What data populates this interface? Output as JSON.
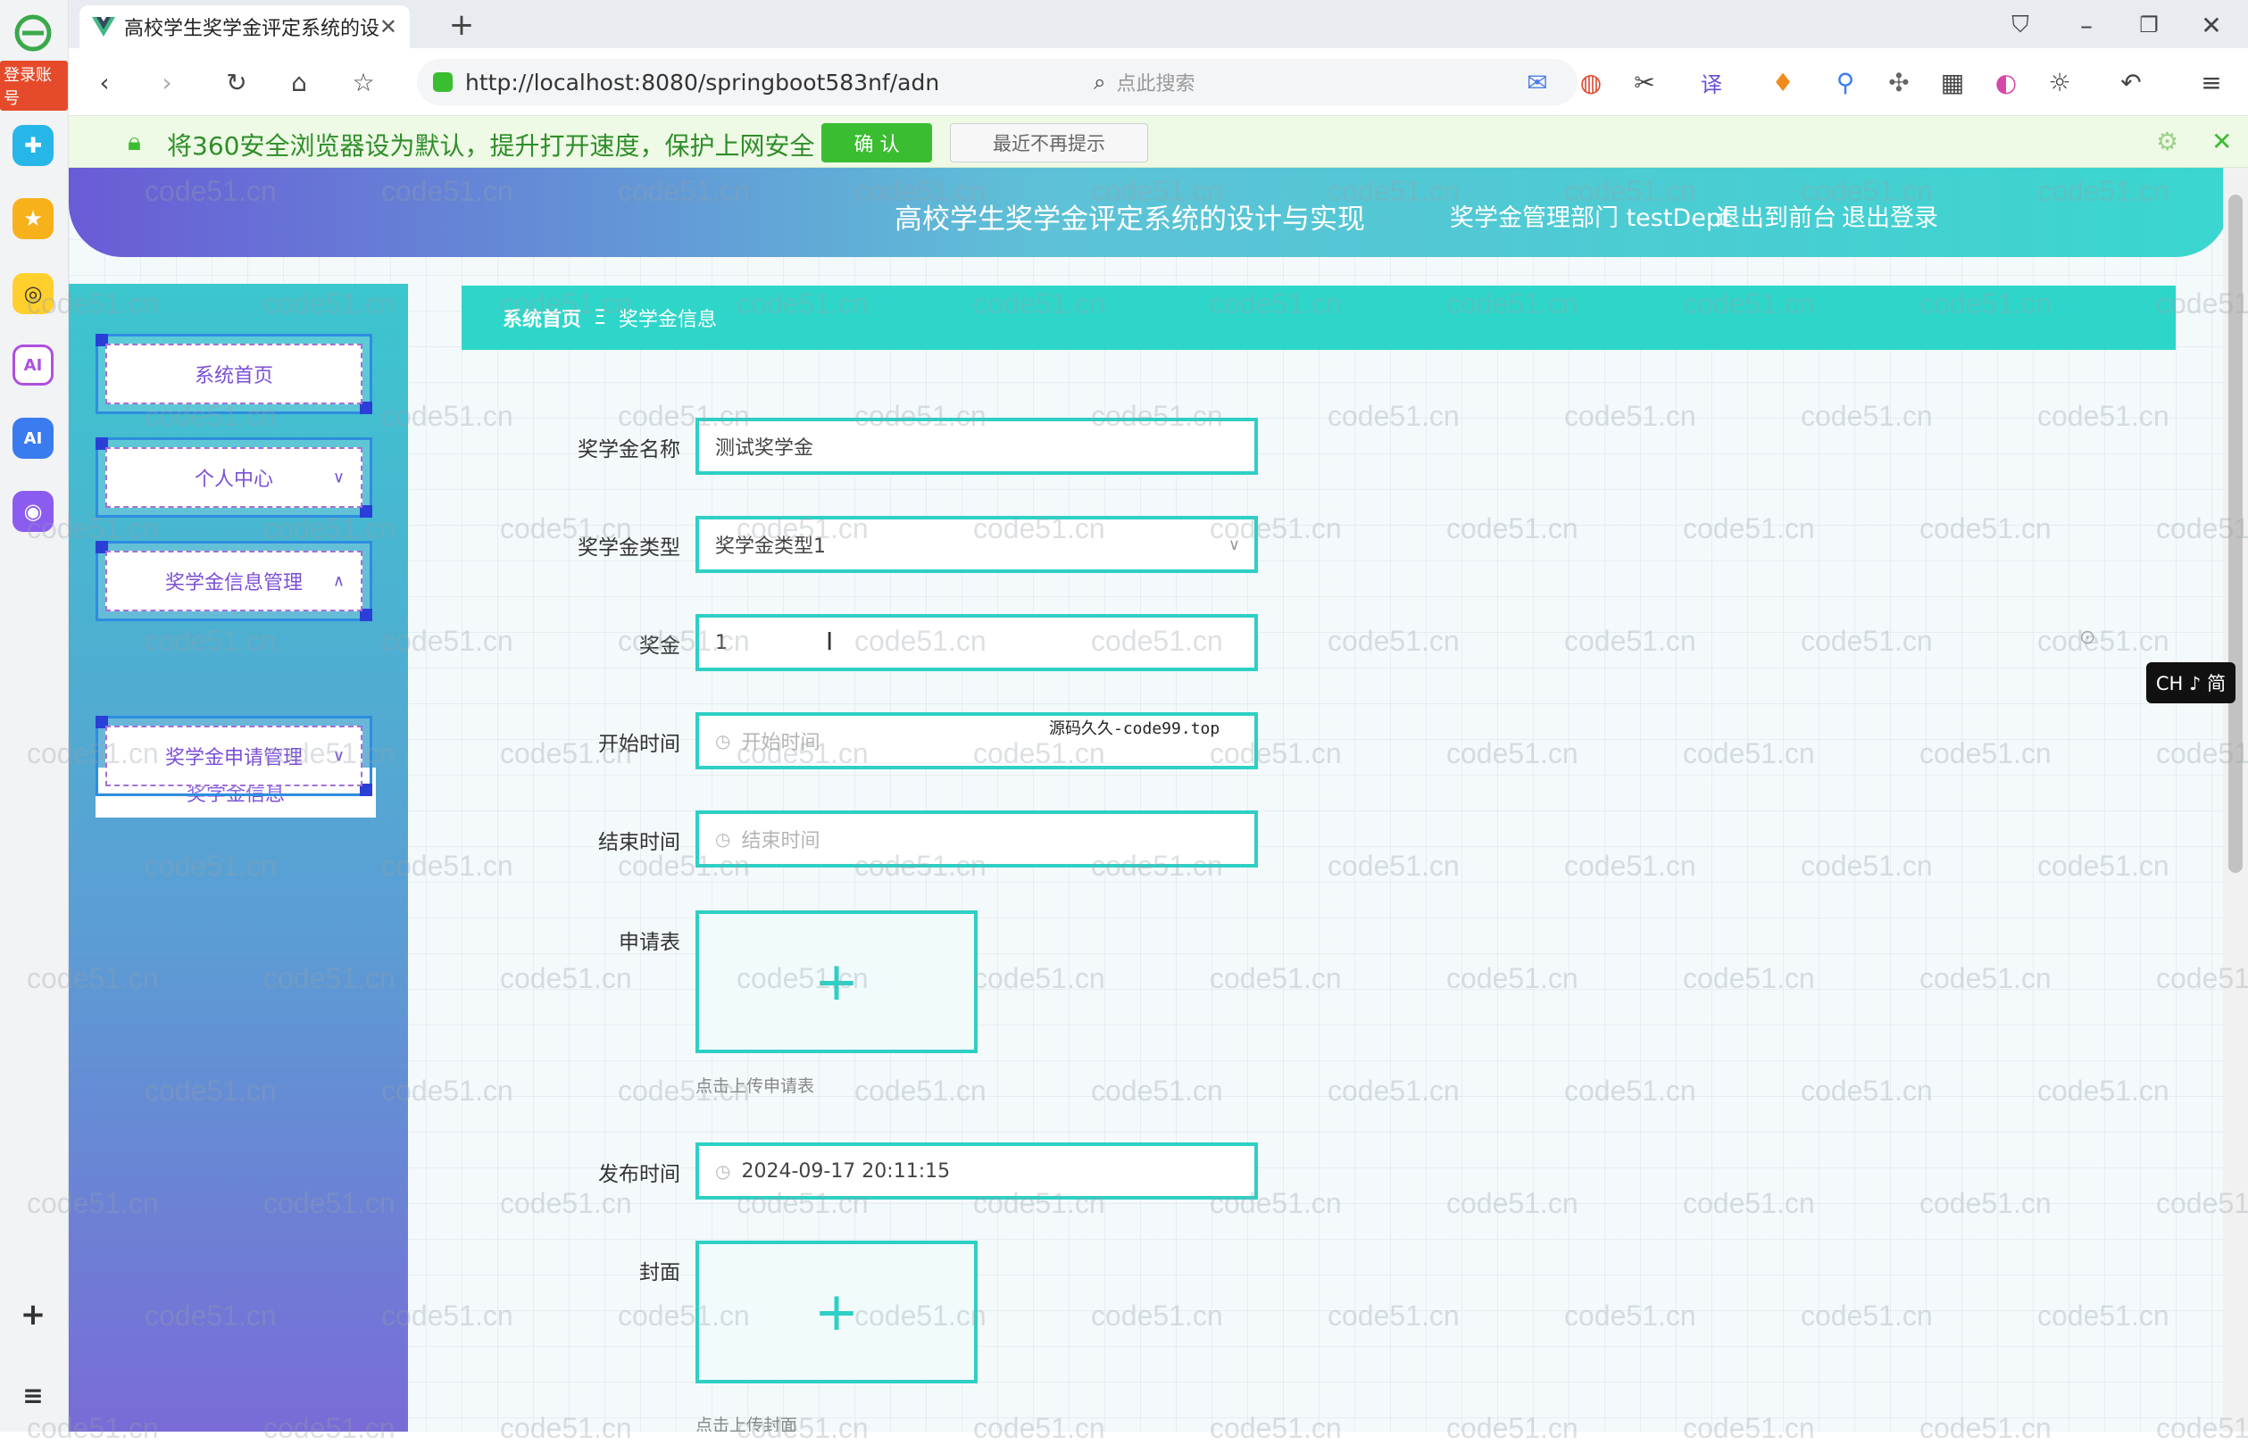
{
  "browser": {
    "tab_title": "高校学生奖学金评定系统的设计",
    "new_tab_symbol": "+",
    "url": "http://localhost:8080/springboot583nf/adn",
    "search_placeholder": "点此搜索",
    "login_badge": "登录账号"
  },
  "notification": {
    "message": "将360安全浏览器设为默认，提升打开速度，保护上网安全",
    "confirm_label": "确 认",
    "dismiss_label": "最近不再提示"
  },
  "header": {
    "title": "高校学生奖学金评定系统的设计与实现",
    "user": "奖学金管理部门 testDept",
    "front_link": "退出到前台",
    "logout_link": "退出登录"
  },
  "sidebar": {
    "items": [
      {
        "label": "系统首页"
      },
      {
        "label": "个人中心"
      },
      {
        "label": "奖学金信息管理"
      },
      {
        "label": "奖学金申请管理"
      }
    ],
    "subitem": "奖学金信息"
  },
  "breadcrumb": {
    "home": "系统首页",
    "separator": "Ξ",
    "current": "奖学金信息"
  },
  "form": {
    "name": {
      "label": "奖学金名称",
      "value": "测试奖学金"
    },
    "type": {
      "label": "奖学金类型",
      "value": "奖学金类型1"
    },
    "amount": {
      "label": "奖金",
      "value": "1"
    },
    "start": {
      "label": "开始时间",
      "placeholder": "开始时间"
    },
    "end": {
      "label": "结束时间",
      "placeholder": "结束时间"
    },
    "application": {
      "label": "申请表",
      "hint": "点击上传申请表"
    },
    "publish": {
      "label": "发布时间",
      "value": "2024-09-17 20:11:15"
    },
    "cover": {
      "label": "封面",
      "hint": "点击上传封面"
    }
  },
  "overlay_text": "源码久久-code99.top",
  "ime": "CH ♪ 简",
  "watermark": "code51.cn",
  "colors": {
    "accent": "#2ecfc4",
    "menu_text": "#7b4fd6",
    "notify_green": "#3bbd32"
  }
}
